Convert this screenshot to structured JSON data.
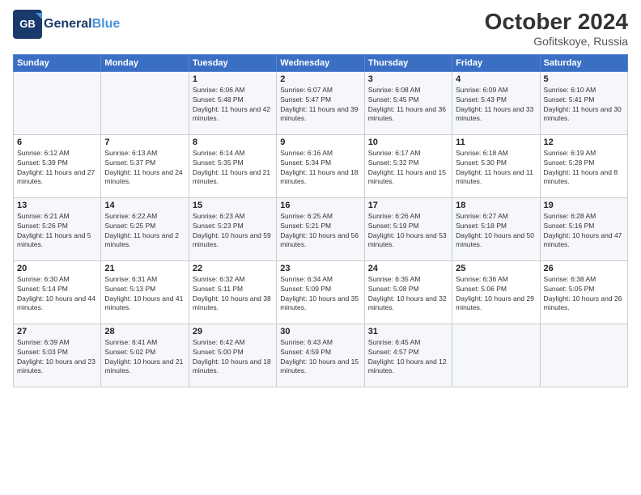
{
  "header": {
    "logo_line1": "General",
    "logo_line2": "Blue",
    "month": "October 2024",
    "location": "Gofitskoye, Russia"
  },
  "days_of_week": [
    "Sunday",
    "Monday",
    "Tuesday",
    "Wednesday",
    "Thursday",
    "Friday",
    "Saturday"
  ],
  "weeks": [
    [
      {
        "day": "",
        "sunrise": "",
        "sunset": "",
        "daylight": ""
      },
      {
        "day": "",
        "sunrise": "",
        "sunset": "",
        "daylight": ""
      },
      {
        "day": "1",
        "sunrise": "Sunrise: 6:06 AM",
        "sunset": "Sunset: 5:48 PM",
        "daylight": "Daylight: 11 hours and 42 minutes."
      },
      {
        "day": "2",
        "sunrise": "Sunrise: 6:07 AM",
        "sunset": "Sunset: 5:47 PM",
        "daylight": "Daylight: 11 hours and 39 minutes."
      },
      {
        "day": "3",
        "sunrise": "Sunrise: 6:08 AM",
        "sunset": "Sunset: 5:45 PM",
        "daylight": "Daylight: 11 hours and 36 minutes."
      },
      {
        "day": "4",
        "sunrise": "Sunrise: 6:09 AM",
        "sunset": "Sunset: 5:43 PM",
        "daylight": "Daylight: 11 hours and 33 minutes."
      },
      {
        "day": "5",
        "sunrise": "Sunrise: 6:10 AM",
        "sunset": "Sunset: 5:41 PM",
        "daylight": "Daylight: 11 hours and 30 minutes."
      }
    ],
    [
      {
        "day": "6",
        "sunrise": "Sunrise: 6:12 AM",
        "sunset": "Sunset: 5:39 PM",
        "daylight": "Daylight: 11 hours and 27 minutes."
      },
      {
        "day": "7",
        "sunrise": "Sunrise: 6:13 AM",
        "sunset": "Sunset: 5:37 PM",
        "daylight": "Daylight: 11 hours and 24 minutes."
      },
      {
        "day": "8",
        "sunrise": "Sunrise: 6:14 AM",
        "sunset": "Sunset: 5:35 PM",
        "daylight": "Daylight: 11 hours and 21 minutes."
      },
      {
        "day": "9",
        "sunrise": "Sunrise: 6:16 AM",
        "sunset": "Sunset: 5:34 PM",
        "daylight": "Daylight: 11 hours and 18 minutes."
      },
      {
        "day": "10",
        "sunrise": "Sunrise: 6:17 AM",
        "sunset": "Sunset: 5:32 PM",
        "daylight": "Daylight: 11 hours and 15 minutes."
      },
      {
        "day": "11",
        "sunrise": "Sunrise: 6:18 AM",
        "sunset": "Sunset: 5:30 PM",
        "daylight": "Daylight: 11 hours and 11 minutes."
      },
      {
        "day": "12",
        "sunrise": "Sunrise: 6:19 AM",
        "sunset": "Sunset: 5:28 PM",
        "daylight": "Daylight: 11 hours and 8 minutes."
      }
    ],
    [
      {
        "day": "13",
        "sunrise": "Sunrise: 6:21 AM",
        "sunset": "Sunset: 5:26 PM",
        "daylight": "Daylight: 11 hours and 5 minutes."
      },
      {
        "day": "14",
        "sunrise": "Sunrise: 6:22 AM",
        "sunset": "Sunset: 5:25 PM",
        "daylight": "Daylight: 11 hours and 2 minutes."
      },
      {
        "day": "15",
        "sunrise": "Sunrise: 6:23 AM",
        "sunset": "Sunset: 5:23 PM",
        "daylight": "Daylight: 10 hours and 59 minutes."
      },
      {
        "day": "16",
        "sunrise": "Sunrise: 6:25 AM",
        "sunset": "Sunset: 5:21 PM",
        "daylight": "Daylight: 10 hours and 56 minutes."
      },
      {
        "day": "17",
        "sunrise": "Sunrise: 6:26 AM",
        "sunset": "Sunset: 5:19 PM",
        "daylight": "Daylight: 10 hours and 53 minutes."
      },
      {
        "day": "18",
        "sunrise": "Sunrise: 6:27 AM",
        "sunset": "Sunset: 5:18 PM",
        "daylight": "Daylight: 10 hours and 50 minutes."
      },
      {
        "day": "19",
        "sunrise": "Sunrise: 6:28 AM",
        "sunset": "Sunset: 5:16 PM",
        "daylight": "Daylight: 10 hours and 47 minutes."
      }
    ],
    [
      {
        "day": "20",
        "sunrise": "Sunrise: 6:30 AM",
        "sunset": "Sunset: 5:14 PM",
        "daylight": "Daylight: 10 hours and 44 minutes."
      },
      {
        "day": "21",
        "sunrise": "Sunrise: 6:31 AM",
        "sunset": "Sunset: 5:13 PM",
        "daylight": "Daylight: 10 hours and 41 minutes."
      },
      {
        "day": "22",
        "sunrise": "Sunrise: 6:32 AM",
        "sunset": "Sunset: 5:11 PM",
        "daylight": "Daylight: 10 hours and 38 minutes."
      },
      {
        "day": "23",
        "sunrise": "Sunrise: 6:34 AM",
        "sunset": "Sunset: 5:09 PM",
        "daylight": "Daylight: 10 hours and 35 minutes."
      },
      {
        "day": "24",
        "sunrise": "Sunrise: 6:35 AM",
        "sunset": "Sunset: 5:08 PM",
        "daylight": "Daylight: 10 hours and 32 minutes."
      },
      {
        "day": "25",
        "sunrise": "Sunrise: 6:36 AM",
        "sunset": "Sunset: 5:06 PM",
        "daylight": "Daylight: 10 hours and 29 minutes."
      },
      {
        "day": "26",
        "sunrise": "Sunrise: 6:38 AM",
        "sunset": "Sunset: 5:05 PM",
        "daylight": "Daylight: 10 hours and 26 minutes."
      }
    ],
    [
      {
        "day": "27",
        "sunrise": "Sunrise: 6:39 AM",
        "sunset": "Sunset: 5:03 PM",
        "daylight": "Daylight: 10 hours and 23 minutes."
      },
      {
        "day": "28",
        "sunrise": "Sunrise: 6:41 AM",
        "sunset": "Sunset: 5:02 PM",
        "daylight": "Daylight: 10 hours and 21 minutes."
      },
      {
        "day": "29",
        "sunrise": "Sunrise: 6:42 AM",
        "sunset": "Sunset: 5:00 PM",
        "daylight": "Daylight: 10 hours and 18 minutes."
      },
      {
        "day": "30",
        "sunrise": "Sunrise: 6:43 AM",
        "sunset": "Sunset: 4:59 PM",
        "daylight": "Daylight: 10 hours and 15 minutes."
      },
      {
        "day": "31",
        "sunrise": "Sunrise: 6:45 AM",
        "sunset": "Sunset: 4:57 PM",
        "daylight": "Daylight: 10 hours and 12 minutes."
      },
      {
        "day": "",
        "sunrise": "",
        "sunset": "",
        "daylight": ""
      },
      {
        "day": "",
        "sunrise": "",
        "sunset": "",
        "daylight": ""
      }
    ]
  ]
}
